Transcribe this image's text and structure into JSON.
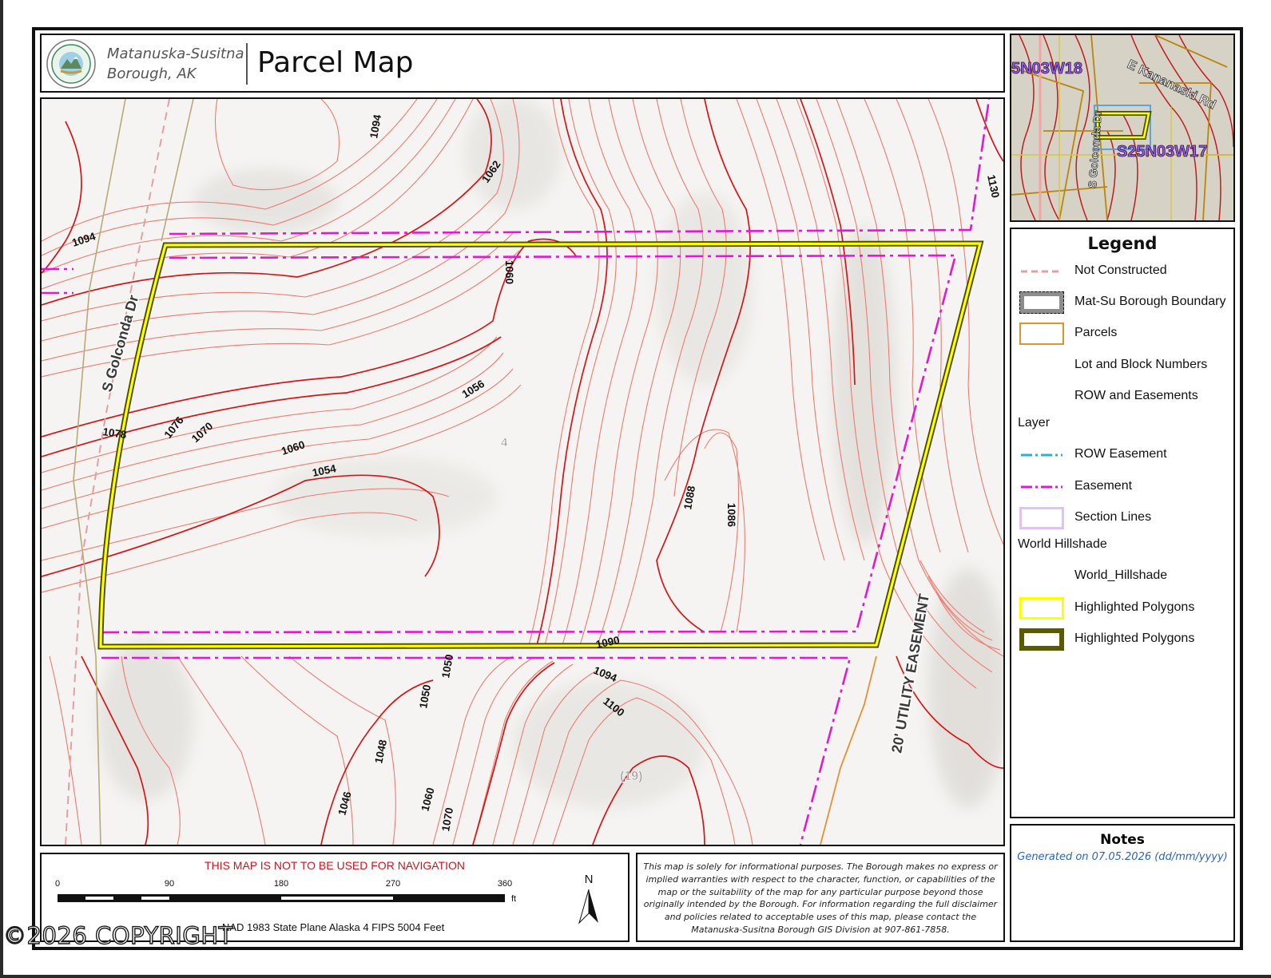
{
  "header": {
    "org_line1": "Matanuska-Susitna",
    "org_line2": "Borough, AK",
    "title": "Parcel Map",
    "logo_icon": "borough-seal-icon"
  },
  "map": {
    "road_label": "S Golconda Dr",
    "easement_label": "20' UTILITY EASEMENT",
    "lot_number": "4",
    "block_number": "(19)",
    "contour_labels": [
      "1094",
      "1094",
      "1062",
      "1130",
      "1060",
      "1056",
      "1078",
      "1076",
      "1070",
      "1060",
      "1054",
      "1088",
      "1086",
      "1090",
      "1094",
      "1100",
      "1050",
      "1050",
      "1048",
      "1046",
      "1060",
      "1070"
    ],
    "colors": {
      "contour_major": "#d81414",
      "contour_minor": "#f07a6c",
      "easement": "#e318d2",
      "parcel_highlight": "#ffff00",
      "parcel_outline": "#5a5a00",
      "parcel_line": "#e6912e",
      "not_constructed": "#e4a0a0"
    }
  },
  "inset": {
    "labels": [
      "5N03W18",
      "E Kananaski Rd",
      "S25N03W17",
      "S Golconda Dr"
    ]
  },
  "legend": {
    "title": "Legend",
    "items": [
      {
        "label": "Not Constructed",
        "icon": "dashed-pink-line"
      },
      {
        "label": "Mat-Su Borough Boundary",
        "icon": "gray-boundary-box"
      },
      {
        "label": "Parcels",
        "icon": "orange-outline-box"
      },
      {
        "label": "Lot and Block Numbers",
        "icon": "none"
      },
      {
        "label": "ROW and Easements",
        "icon": "none"
      }
    ],
    "group_layer": "Layer",
    "layer_items": [
      {
        "label": "ROW Easement",
        "icon": "blue-dash-dot-line"
      },
      {
        "label": "Easement",
        "icon": "magenta-dash-dot-line"
      },
      {
        "label": "Section Lines",
        "icon": "lavender-outline-box"
      }
    ],
    "group_hillshade": "World Hillshade",
    "hillshade_items": [
      {
        "label": "World_Hillshade",
        "icon": "none"
      },
      {
        "label": "Highlighted Polygons",
        "icon": "yellow-outline-box"
      },
      {
        "label": "Highlighted Polygons",
        "icon": "olive-thick-outline-box"
      }
    ]
  },
  "notes": {
    "title": "Notes",
    "text": "Generated on  07.05.2026  (dd/mm/yyyy)"
  },
  "scalebar": {
    "warning": "THIS MAP IS NOT TO BE USED FOR NAVIGATION",
    "ticks": [
      "0",
      "90",
      "180",
      "270",
      "360"
    ],
    "unit": "ft",
    "north_label": "N",
    "crs": "NAD 1983 State Plane Alaska 4 FIPS 5004 Feet"
  },
  "disclaimer": {
    "text": "This map is solely for informational purposes. The Borough makes no express or implied warranties with respect to the character, function, or capabilities of the map or the suitability of the map for any particular purpose beyond those originally intended by the Borough. For information regarding the full disclaimer and policies related to acceptable uses of this map, please contact the Matanuska-Susitna Borough GIS Division at 907-861-7858."
  },
  "watermark": {
    "text": "©2026 COPYRIGHT"
  }
}
